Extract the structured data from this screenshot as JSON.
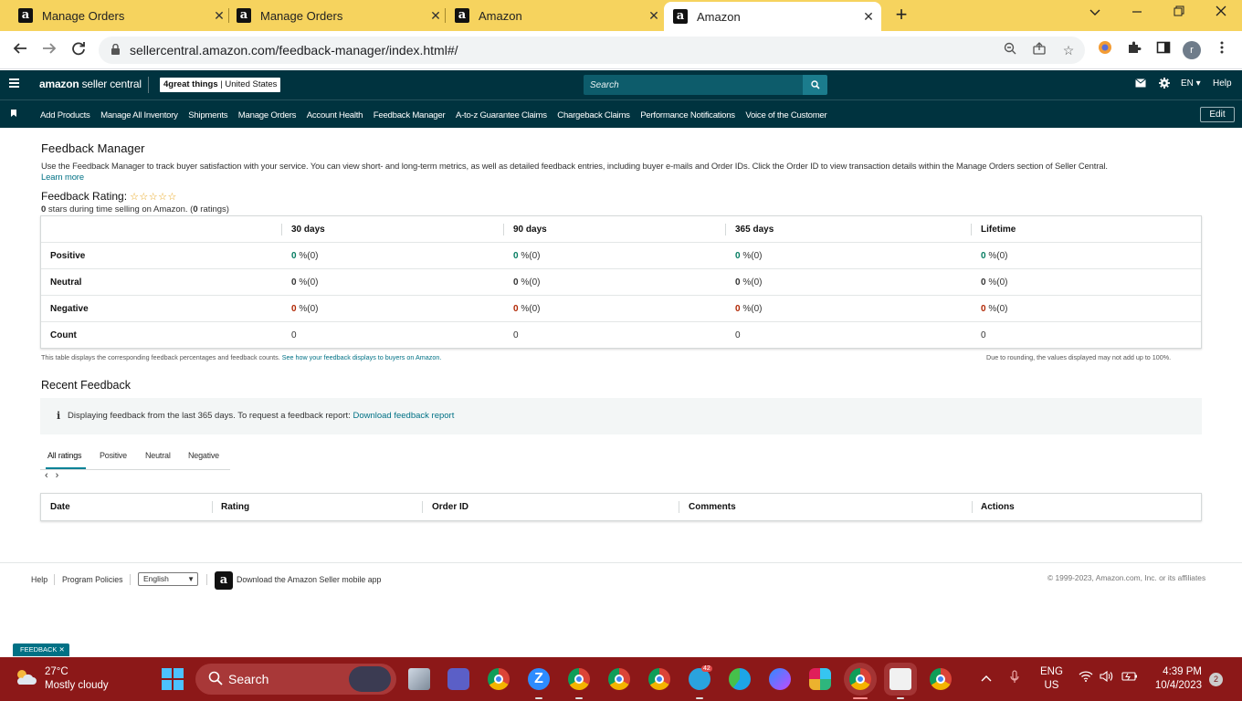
{
  "browser": {
    "tabs": [
      {
        "title": "Manage Orders",
        "favicon": "a",
        "active": false
      },
      {
        "title": "Manage Orders",
        "favicon": "a",
        "active": false
      },
      {
        "title": "Amazon",
        "favicon": "a",
        "active": false
      },
      {
        "title": "Amazon",
        "favicon": "a",
        "active": true
      }
    ],
    "close_glyph": "✕",
    "new_tab_glyph": "+",
    "url": "sellercentral.amazon.com/feedback-manager/index.html#/",
    "profile_initial": "r"
  },
  "header": {
    "logo_bold": "amazon",
    "logo_rest": " seller central",
    "store_bold": "4great things",
    "store_rest": " | United States",
    "search_placeholder": "Search",
    "lang": "EN ▾",
    "help": "Help"
  },
  "nav": {
    "items": [
      "Add Products",
      "Manage All Inventory",
      "Shipments",
      "Manage Orders",
      "Account Health",
      "Feedback Manager",
      "A-to-z Guarantee Claims",
      "Chargeback Claims",
      "Performance Notifications",
      "Voice of the Customer"
    ],
    "edit": "Edit"
  },
  "page": {
    "title": "Feedback Manager",
    "intro": "Use the Feedback Manager to track buyer satisfaction with your service. You can view short- and long-term metrics, as well as detailed feedback entries, including buyer e-mails and Order IDs. Click the Order ID to view transaction details within the Manage Orders section of Seller Central.",
    "learn_more": "Learn more",
    "rating_label": "Feedback Rating:",
    "stars": "☆☆☆☆☆",
    "stars_count": "0",
    "stars_text": " stars during time selling on Amazon. (",
    "ratings_count": "0",
    "ratings_text": " ratings)"
  },
  "feedback_table": {
    "columns": [
      "30 days",
      "90 days",
      "365 days",
      "Lifetime"
    ],
    "rows": [
      {
        "label": "Positive",
        "kind": "pos",
        "cells": [
          {
            "v": "0",
            "s": " %(0)"
          },
          {
            "v": "0",
            "s": " %(0)"
          },
          {
            "v": "0",
            "s": " %(0)"
          },
          {
            "v": "0",
            "s": " %(0)"
          }
        ]
      },
      {
        "label": "Neutral",
        "kind": "neu",
        "cells": [
          {
            "v": "0",
            "s": " %(0)"
          },
          {
            "v": "0",
            "s": " %(0)"
          },
          {
            "v": "0",
            "s": " %(0)"
          },
          {
            "v": "0",
            "s": " %(0)"
          }
        ]
      },
      {
        "label": "Negative",
        "kind": "neg",
        "cells": [
          {
            "v": "0",
            "s": " %(0)"
          },
          {
            "v": "0",
            "s": " %(0)"
          },
          {
            "v": "0",
            "s": " %(0)"
          },
          {
            "v": "0",
            "s": " %(0)"
          }
        ]
      },
      {
        "label": "Count",
        "kind": "plain",
        "cells": [
          {
            "v": "0",
            "s": ""
          },
          {
            "v": "0",
            "s": ""
          },
          {
            "v": "0",
            "s": ""
          },
          {
            "v": "0",
            "s": ""
          }
        ]
      }
    ],
    "note_left": "This table displays the corresponding feedback percentages and feedback counts. ",
    "note_link": "See how your feedback displays to buyers on Amazon.",
    "note_right": "Due to rounding, the values displayed may not add up to 100%."
  },
  "recent": {
    "title": "Recent Feedback",
    "info_icon": "i",
    "info_text": "Displaying feedback from the last 365 days. To request a feedback report: ",
    "info_link": "Download feedback report",
    "tabs": [
      "All ratings",
      "Positive",
      "Neutral",
      "Negative"
    ],
    "pager_prev": "‹",
    "pager_next": "›",
    "columns": [
      "Date",
      "Rating",
      "Order ID",
      "Comments",
      "Actions"
    ]
  },
  "footer": {
    "help": "Help",
    "policies": "Program Policies",
    "language": "English",
    "app_text": "Download the Amazon Seller mobile app",
    "copyright": "© 1999-2023, Amazon.com, Inc. or its affiliates"
  },
  "feedback_button": "FEEDBACK ✕",
  "taskbar": {
    "temp": "27°C",
    "weather": "Mostly cloudy",
    "search": "Search",
    "lang_top": "ENG",
    "lang_bottom": "US",
    "time": "4:39 PM",
    "date": "10/4/2023",
    "notifications": "2",
    "telegram_badge": "42",
    "background": "#8c1818"
  }
}
